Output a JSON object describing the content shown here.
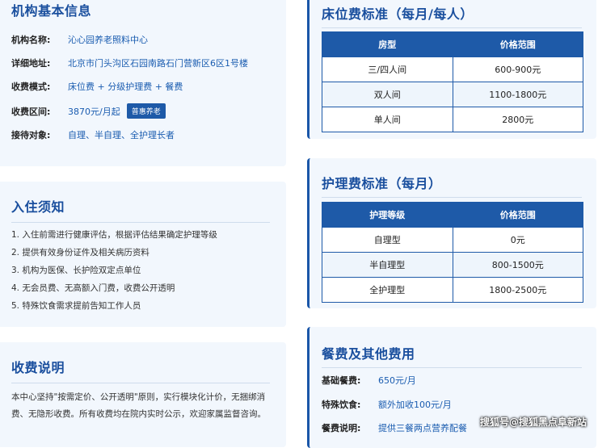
{
  "basic_info": {
    "title": "机构基本信息",
    "rows": [
      {
        "label": "机构名称:",
        "value": "沁心园养老照料中心"
      },
      {
        "label": "详细地址:",
        "value": "北京市门头沟区石园南路石门营新区6区1号楼"
      },
      {
        "label": "收费模式:",
        "value": "床位费 + 分级护理费 + 餐费"
      },
      {
        "label": "收费区间:",
        "value": "3870元/月起"
      },
      {
        "label": "接待对象:",
        "value": "自理、半自理、全护理长者"
      }
    ],
    "badge": "普惠养老"
  },
  "admission": {
    "title": "入住须知",
    "items": [
      "1. 入住前需进行健康评估，根据评估结果确定护理等级",
      "2. 提供有效身份证件及相关病历资料",
      "3. 机构为医保、长护险双定点单位",
      "4. 无会员费、无高额入门费，收费公开透明",
      "5. 特殊饮食需求提前告知工作人员"
    ]
  },
  "fee_note": {
    "title": "收费说明",
    "text": "本中心坚持\"按需定价、公开透明\"原则，实行模块化计价，无捆绑消费、无隐形收费。所有收费均在院内实时公示，欢迎家属监督咨询。"
  },
  "bed_fee": {
    "title": "床位费标准（每月/每人）",
    "headers": [
      "房型",
      "价格范围"
    ],
    "rows": [
      [
        "三/四人间",
        "600-900元"
      ],
      [
        "双人间",
        "1100-1800元"
      ],
      [
        "单人间",
        "2800元"
      ]
    ]
  },
  "care_fee": {
    "title": "护理费标准（每月）",
    "headers": [
      "护理等级",
      "价格范围"
    ],
    "rows": [
      [
        "自理型",
        "0元"
      ],
      [
        "半自理型",
        "800-1500元"
      ],
      [
        "全护理型",
        "1800-2500元"
      ]
    ]
  },
  "meal_fee": {
    "title": "餐费及其他费用",
    "rows": [
      {
        "label": "基础餐费:",
        "value": "650元/月"
      },
      {
        "label": "特殊饮食:",
        "value": "额外加收100元/月"
      },
      {
        "label": "餐费说明:",
        "value": "提供三餐两点营养配餐"
      }
    ]
  },
  "watermark": "搜狐号@搜狐黑点阜新站",
  "colors": {
    "accent": "#1a4f9e",
    "header_bg": "#1e5aa8",
    "card_bg": "#f2f7fd"
  }
}
